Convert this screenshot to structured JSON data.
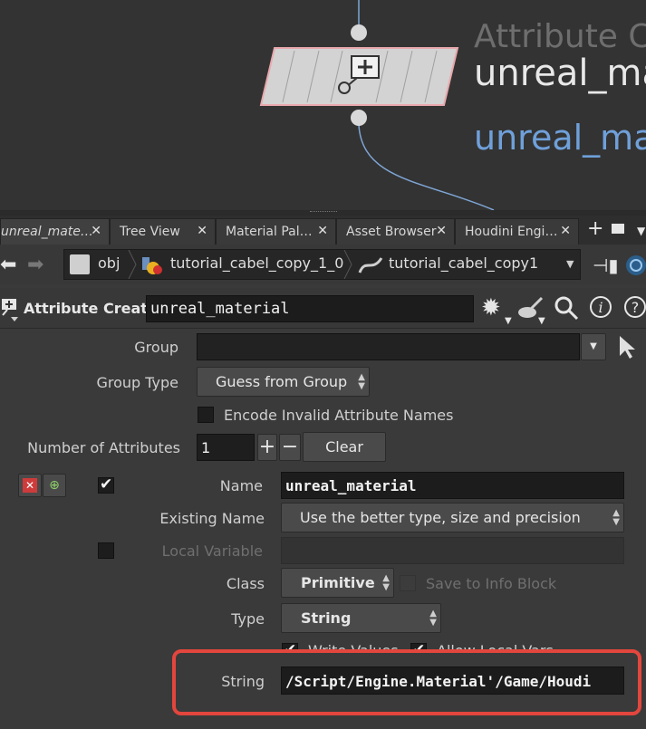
{
  "network": {
    "node_type_label": "Attribute Cre",
    "node_name": "unreal_ma",
    "node_comment": "unreal_mat"
  },
  "tabs": [
    {
      "label": "unreal_mate…",
      "active": true
    },
    {
      "label": "Tree View"
    },
    {
      "label": "Material Pal…"
    },
    {
      "label": "Asset Browser"
    },
    {
      "label": "Houdini Engi…"
    }
  ],
  "path": {
    "crumb1": "obj",
    "crumb2": "tutorial_cabel_copy_1_0",
    "crumb3": "tutorial_cabel_copy1"
  },
  "node_header": {
    "type_label": "Attribute Create",
    "name_value": "unreal_material"
  },
  "params": {
    "group_label": "Group",
    "group_value": "",
    "group_type_label": "Group Type",
    "group_type_value": "Guess from Group",
    "encode_label": "Encode Invalid Attribute Names",
    "num_attrs_label": "Number of Attributes",
    "num_attrs_value": "1",
    "clear_label": "Clear",
    "name_label": "Name",
    "name_value": "unreal_material",
    "existing_name_label": "Existing Name",
    "existing_name_value": "Use the better type, size and precision",
    "local_var_label": "Local Variable",
    "class_label": "Class",
    "class_value": "Primitive",
    "save_info_label": "Save to Info Block",
    "type_label": "Type",
    "type_value": "String",
    "write_values_label": "Write Values",
    "allow_local_vars_label": "Allow Local Vars",
    "string_label": "String",
    "string_value": "/Script/Engine.Material'/Game/Houdi"
  },
  "colors": {
    "highlight_box": "#e3463d",
    "node_comment": "#6fa0da",
    "wire": "#7fa6d6"
  }
}
